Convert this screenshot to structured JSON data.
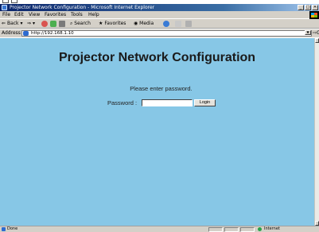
{
  "window": {
    "title": "Projector Network Configuration - Microsoft Internet Explorer",
    "min_glyph": "_",
    "max_glyph": "□",
    "close_glyph": "✕"
  },
  "menu": {
    "items": [
      "File",
      "Edit",
      "View",
      "Favorites",
      "Tools",
      "Help"
    ]
  },
  "toolbar": {
    "back_label": "Back",
    "forward_glyph": "⇒",
    "search_label": "Search",
    "favorites_label": "Favorites",
    "media_label": "Media"
  },
  "address": {
    "label": "Address",
    "url": "http://192.168.1.10",
    "go_label": "Go"
  },
  "page": {
    "heading": "Projector Network Configuration",
    "prompt": "Please enter password.",
    "password_label": "Password :",
    "password_value": "",
    "login_label": "Login",
    "background_color": "#87c7e6"
  },
  "status": {
    "text": "Done",
    "zone": "Internet"
  },
  "icons": {
    "app": "ie-icon",
    "back": "back-arrow-icon",
    "stop": "stop-icon",
    "refresh": "refresh-icon",
    "home": "home-icon",
    "search": "search-icon",
    "favorites": "favorites-icon",
    "media": "media-icon",
    "history": "history-icon",
    "mail": "mail-icon",
    "print": "print-icon",
    "go": "go-arrow-icon",
    "zone": "internet-globe-icon"
  }
}
